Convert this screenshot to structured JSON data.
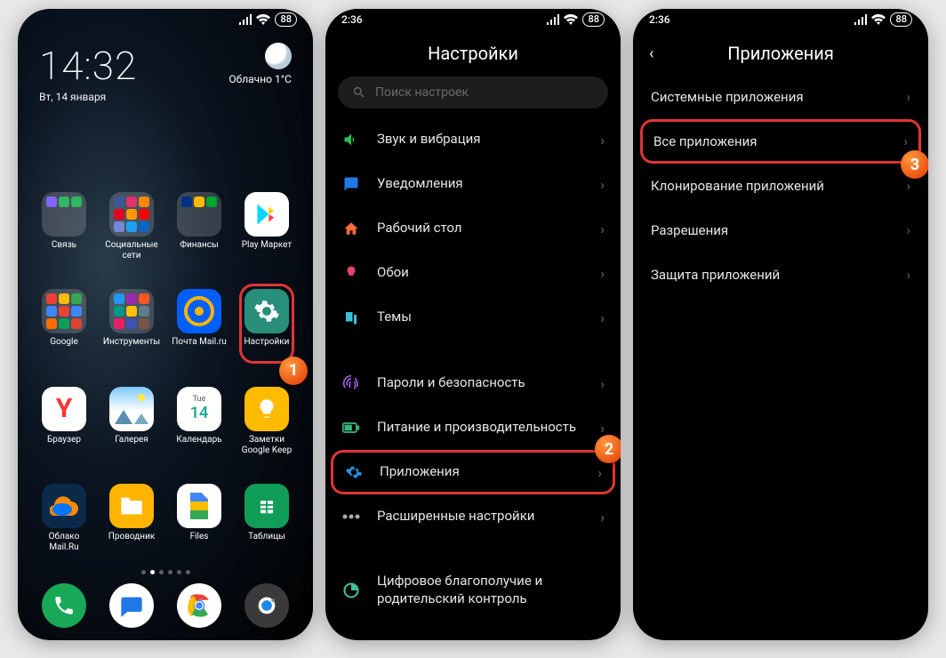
{
  "status": {
    "time": "2:36",
    "battery": "88"
  },
  "home": {
    "clock": "14:32",
    "date": "Вт, 14 января",
    "weather_desc": "Облачно",
    "weather_temp": "1°C",
    "apps": {
      "r1c1": "Связь",
      "r1c2": "Социальные сети",
      "r1c3": "Финансы",
      "r1c4": "Play Маркет",
      "r2c1": "Google",
      "r2c2": "Инструменты",
      "r2c3": "Почта Mail.ru",
      "r2c4": "Настройки",
      "r3c1": "Браузер",
      "r3c2": "Галерея",
      "r3c3": "Календарь",
      "r3c4": "Заметки Google Keep",
      "r4c1": "Облако Mail.Ru",
      "r4c2": "Проводник",
      "r4c3": "Files",
      "r4c4": "Таблицы"
    }
  },
  "callouts": {
    "one": "1",
    "two": "2",
    "three": "3"
  },
  "settings": {
    "title": "Настройки",
    "search_placeholder": "Поиск настроек",
    "rows": {
      "sound": "Звук и вибрация",
      "notifications": "Уведомления",
      "desktop": "Рабочий стол",
      "wallpaper": "Обои",
      "themes": "Темы",
      "passwords": "Пароли и безопасность",
      "power": "Питание и производительность",
      "apps": "Приложения",
      "advanced": "Расширенные настройки",
      "wellbeing": "Цифровое благополучие и родительский контроль"
    }
  },
  "apps_screen": {
    "title": "Приложения",
    "rows": {
      "system": "Системные приложения",
      "all": "Все приложения",
      "clone": "Клонирование приложений",
      "permissions": "Разрешения",
      "protect": "Защита приложений"
    }
  }
}
